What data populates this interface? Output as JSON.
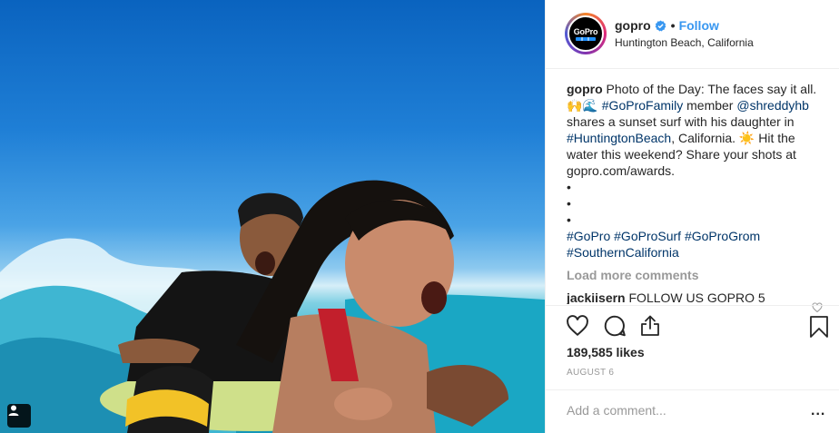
{
  "post": {
    "username": "gopro",
    "follow_label": "Follow",
    "separator": "•",
    "location": "Huntington Beach, California",
    "avatar_text": "GoPro"
  },
  "caption": {
    "author": "gopro",
    "text_1": "Photo of the Day: The faces say it all. 🙌🌊",
    "hashtag_family": "#GoProFamily",
    "text_2": "member",
    "mention": "@shreddyhb",
    "text_3": "shares a sunset surf with his daughter in",
    "hashtag_location": "#HuntingtonBeach",
    "text_4": ", California. ☀️ Hit the water this weekend? Share your shots at gopro.com/awards.",
    "bullets": [
      "•",
      "•",
      "•"
    ],
    "hashtags": [
      "#GoPro",
      "#GoProSurf",
      "#GoProGrom",
      "#SouthernCalifornia"
    ]
  },
  "comments": {
    "load_more_label": "Load more comments",
    "items": [
      {
        "author": "jackiisern",
        "text": "FOLLOW US GOPRO 5"
      }
    ]
  },
  "stats": {
    "likes": "189,585 likes",
    "date": "AUGUST 6"
  },
  "add_comment": {
    "placeholder": "Add a comment...",
    "more_label": "..."
  },
  "icons": {
    "like": "heart-icon",
    "comment": "comment-icon",
    "share": "share-icon",
    "save": "bookmark-icon",
    "tag": "user-tag-icon",
    "verified": "verified-badge-icon"
  },
  "colors": {
    "link": "#003569",
    "follow": "#3897f0",
    "muted": "#999999",
    "text": "#262626"
  }
}
